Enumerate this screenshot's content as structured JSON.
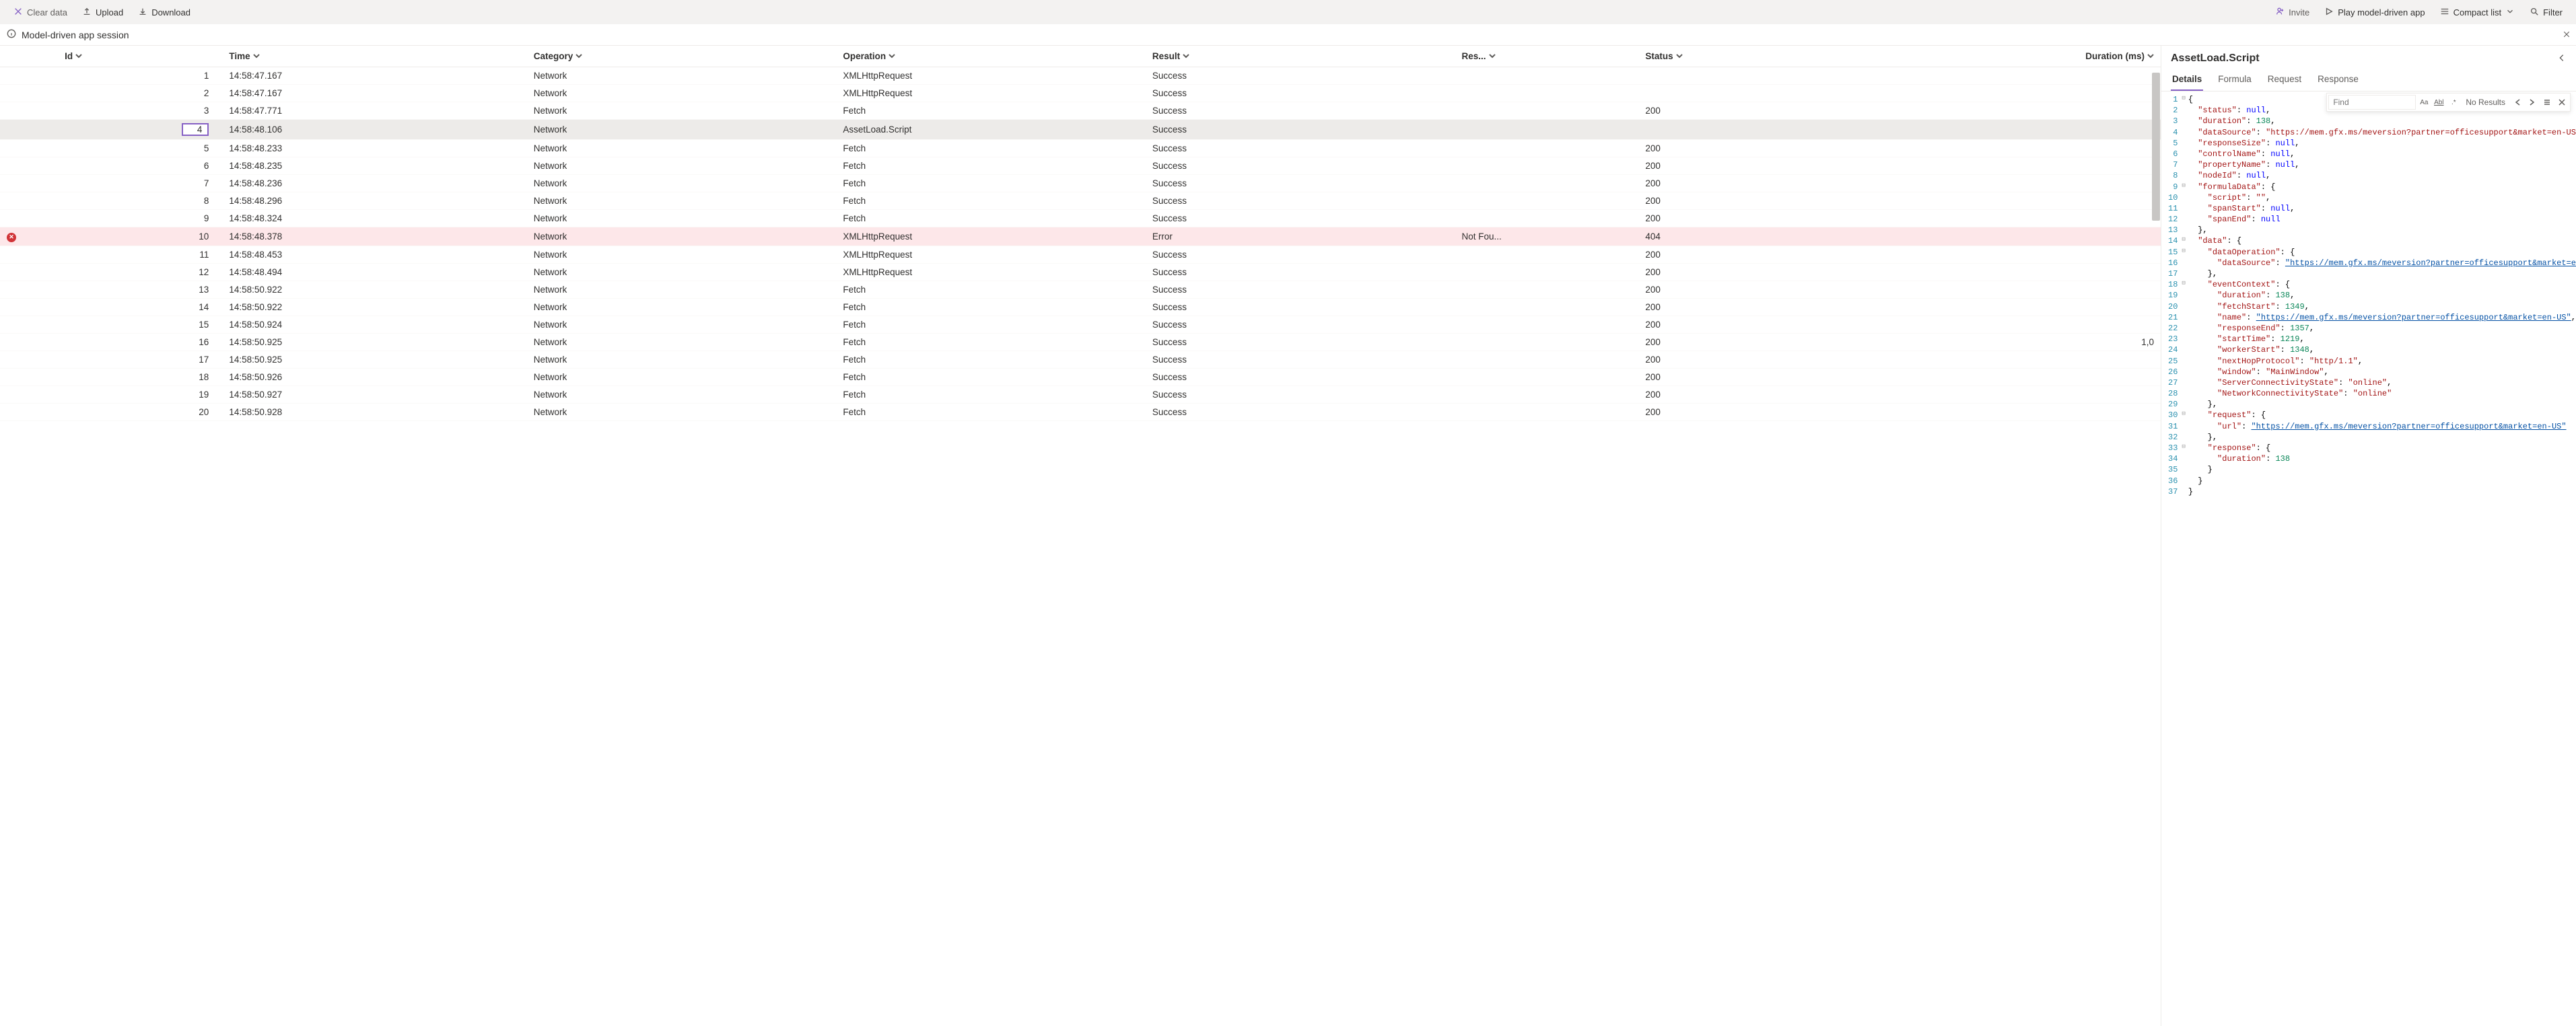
{
  "toolbar": {
    "clear": "Clear data",
    "upload": "Upload",
    "download": "Download",
    "invite": "Invite",
    "play": "Play model-driven app",
    "compact": "Compact list",
    "filter": "Filter"
  },
  "session": {
    "title": "Model-driven app session"
  },
  "table": {
    "headers": {
      "id": "Id",
      "time": "Time",
      "category": "Category",
      "operation": "Operation",
      "result": "Result",
      "result_msg": "Res...",
      "status": "Status",
      "duration": "Duration (ms)"
    },
    "rows": [
      {
        "id": 1,
        "time": "14:58:47.167",
        "cat": "Network",
        "op": "XMLHttpRequest",
        "res": "Success",
        "msg": "",
        "status": "",
        "dur": ""
      },
      {
        "id": 2,
        "time": "14:58:47.167",
        "cat": "Network",
        "op": "XMLHttpRequest",
        "res": "Success",
        "msg": "",
        "status": "",
        "dur": ""
      },
      {
        "id": 3,
        "time": "14:58:47.771",
        "cat": "Network",
        "op": "Fetch",
        "res": "Success",
        "msg": "",
        "status": "200",
        "dur": ""
      },
      {
        "id": 4,
        "time": "14:58:48.106",
        "cat": "Network",
        "op": "AssetLoad.Script",
        "res": "Success",
        "msg": "",
        "status": "",
        "dur": "",
        "selected": true
      },
      {
        "id": 5,
        "time": "14:58:48.233",
        "cat": "Network",
        "op": "Fetch",
        "res": "Success",
        "msg": "",
        "status": "200",
        "dur": ""
      },
      {
        "id": 6,
        "time": "14:58:48.235",
        "cat": "Network",
        "op": "Fetch",
        "res": "Success",
        "msg": "",
        "status": "200",
        "dur": ""
      },
      {
        "id": 7,
        "time": "14:58:48.236",
        "cat": "Network",
        "op": "Fetch",
        "res": "Success",
        "msg": "",
        "status": "200",
        "dur": ""
      },
      {
        "id": 8,
        "time": "14:58:48.296",
        "cat": "Network",
        "op": "Fetch",
        "res": "Success",
        "msg": "",
        "status": "200",
        "dur": ""
      },
      {
        "id": 9,
        "time": "14:58:48.324",
        "cat": "Network",
        "op": "Fetch",
        "res": "Success",
        "msg": "",
        "status": "200",
        "dur": ""
      },
      {
        "id": 10,
        "time": "14:58:48.378",
        "cat": "Network",
        "op": "XMLHttpRequest",
        "res": "Error",
        "msg": "Not Fou...",
        "status": "404",
        "dur": "",
        "error": true
      },
      {
        "id": 11,
        "time": "14:58:48.453",
        "cat": "Network",
        "op": "XMLHttpRequest",
        "res": "Success",
        "msg": "",
        "status": "200",
        "dur": ""
      },
      {
        "id": 12,
        "time": "14:58:48.494",
        "cat": "Network",
        "op": "XMLHttpRequest",
        "res": "Success",
        "msg": "",
        "status": "200",
        "dur": ""
      },
      {
        "id": 13,
        "time": "14:58:50.922",
        "cat": "Network",
        "op": "Fetch",
        "res": "Success",
        "msg": "",
        "status": "200",
        "dur": ""
      },
      {
        "id": 14,
        "time": "14:58:50.922",
        "cat": "Network",
        "op": "Fetch",
        "res": "Success",
        "msg": "",
        "status": "200",
        "dur": ""
      },
      {
        "id": 15,
        "time": "14:58:50.924",
        "cat": "Network",
        "op": "Fetch",
        "res": "Success",
        "msg": "",
        "status": "200",
        "dur": ""
      },
      {
        "id": 16,
        "time": "14:58:50.925",
        "cat": "Network",
        "op": "Fetch",
        "res": "Success",
        "msg": "",
        "status": "200",
        "dur": "1,0"
      },
      {
        "id": 17,
        "time": "14:58:50.925",
        "cat": "Network",
        "op": "Fetch",
        "res": "Success",
        "msg": "",
        "status": "200",
        "dur": ""
      },
      {
        "id": 18,
        "time": "14:58:50.926",
        "cat": "Network",
        "op": "Fetch",
        "res": "Success",
        "msg": "",
        "status": "200",
        "dur": ""
      },
      {
        "id": 19,
        "time": "14:58:50.927",
        "cat": "Network",
        "op": "Fetch",
        "res": "Success",
        "msg": "",
        "status": "200",
        "dur": ""
      },
      {
        "id": 20,
        "time": "14:58:50.928",
        "cat": "Network",
        "op": "Fetch",
        "res": "Success",
        "msg": "",
        "status": "200",
        "dur": ""
      }
    ]
  },
  "right": {
    "title": "AssetLoad.Script",
    "tabs": {
      "details": "Details",
      "formula": "Formula",
      "request": "Request",
      "response": "Response"
    },
    "find": {
      "placeholder": "Find",
      "noresults": "No Results",
      "matchcase": "Aa",
      "wholeword": "Abl",
      "regex": ".*"
    }
  },
  "code": {
    "lines": [
      {
        "n": 1,
        "f": "-",
        "html": "<span class='p'>{</span>"
      },
      {
        "n": 2,
        "html": "  <span class='k'>\"status\"</span><span class='p'>: </span><span class='c-null'>null</span><span class='p'>,</span>"
      },
      {
        "n": 3,
        "html": "  <span class='k'>\"duration\"</span><span class='p'>: </span><span class='n'>138</span><span class='p'>,</span>"
      },
      {
        "n": 4,
        "html": "  <span class='k'>\"dataSource\"</span><span class='p'>: </span><span class='k'>\"https://mem.gfx.ms/meversion?partner=officesupport&amp;market=en-US\"</span><span class='p'>,</span>"
      },
      {
        "n": 5,
        "html": "  <span class='k'>\"responseSize\"</span><span class='p'>: </span><span class='c-null'>null</span><span class='p'>,</span>"
      },
      {
        "n": 6,
        "html": "  <span class='k'>\"controlName\"</span><span class='p'>: </span><span class='c-null'>null</span><span class='p'>,</span>"
      },
      {
        "n": 7,
        "html": "  <span class='k'>\"propertyName\"</span><span class='p'>: </span><span class='c-null'>null</span><span class='p'>,</span>"
      },
      {
        "n": 8,
        "html": "  <span class='k'>\"nodeId\"</span><span class='p'>: </span><span class='c-null'>null</span><span class='p'>,</span>"
      },
      {
        "n": 9,
        "f": "-",
        "html": "  <span class='k'>\"formulaData\"</span><span class='p'>: {</span>"
      },
      {
        "n": 10,
        "html": "    <span class='k'>\"script\"</span><span class='p'>: </span><span class='k'>\"\"</span><span class='p'>,</span>"
      },
      {
        "n": 11,
        "html": "    <span class='k'>\"spanStart\"</span><span class='p'>: </span><span class='c-null'>null</span><span class='p'>,</span>"
      },
      {
        "n": 12,
        "html": "    <span class='k'>\"spanEnd\"</span><span class='p'>: </span><span class='c-null'>null</span>"
      },
      {
        "n": 13,
        "html": "  <span class='p'>},</span>"
      },
      {
        "n": 14,
        "f": "-",
        "html": "  <span class='k'>\"data\"</span><span class='p'>: {</span>"
      },
      {
        "n": 15,
        "f": "-",
        "html": "    <span class='k'>\"dataOperation\"</span><span class='p'>: {</span>"
      },
      {
        "n": 16,
        "html": "      <span class='k'>\"dataSource\"</span><span class='p'>: </span><span class='u'>\"https://mem.gfx.ms/meversion?partner=officesupport&amp;market=en-US\"</span>"
      },
      {
        "n": 17,
        "html": "    <span class='p'>},</span>"
      },
      {
        "n": 18,
        "f": "-",
        "html": "    <span class='k'>\"eventContext\"</span><span class='p'>: {</span>"
      },
      {
        "n": 19,
        "html": "      <span class='k'>\"duration\"</span><span class='p'>: </span><span class='n'>138</span><span class='p'>,</span>"
      },
      {
        "n": 20,
        "html": "      <span class='k'>\"fetchStart\"</span><span class='p'>: </span><span class='n'>1349</span><span class='p'>,</span>"
      },
      {
        "n": 21,
        "html": "      <span class='k'>\"name\"</span><span class='p'>: </span><span class='u'>\"https://mem.gfx.ms/meversion?partner=officesupport&amp;market=en-US\"</span><span class='p'>,</span>"
      },
      {
        "n": 22,
        "html": "      <span class='k'>\"responseEnd\"</span><span class='p'>: </span><span class='n'>1357</span><span class='p'>,</span>"
      },
      {
        "n": 23,
        "html": "      <span class='k'>\"startTime\"</span><span class='p'>: </span><span class='n'>1219</span><span class='p'>,</span>"
      },
      {
        "n": 24,
        "html": "      <span class='k'>\"workerStart\"</span><span class='p'>: </span><span class='n'>1348</span><span class='p'>,</span>"
      },
      {
        "n": 25,
        "html": "      <span class='k'>\"nextHopProtocol\"</span><span class='p'>: </span><span class='k'>\"http/1.1\"</span><span class='p'>,</span>"
      },
      {
        "n": 26,
        "html": "      <span class='k'>\"window\"</span><span class='p'>: </span><span class='k'>\"MainWindow\"</span><span class='p'>,</span>"
      },
      {
        "n": 27,
        "html": "      <span class='k'>\"ServerConnectivityState\"</span><span class='p'>: </span><span class='k'>\"online\"</span><span class='p'>,</span>"
      },
      {
        "n": 28,
        "html": "      <span class='k'>\"NetworkConnectivityState\"</span><span class='p'>: </span><span class='k'>\"online\"</span>"
      },
      {
        "n": 29,
        "html": "    <span class='p'>},</span>"
      },
      {
        "n": 30,
        "f": "-",
        "html": "    <span class='k'>\"request\"</span><span class='p'>: {</span>"
      },
      {
        "n": 31,
        "html": "      <span class='k'>\"url\"</span><span class='p'>: </span><span class='u'>\"https://mem.gfx.ms/meversion?partner=officesupport&amp;market=en-US\"</span>"
      },
      {
        "n": 32,
        "html": "    <span class='p'>},</span>"
      },
      {
        "n": 33,
        "f": "-",
        "html": "    <span class='k'>\"response\"</span><span class='p'>: {</span>"
      },
      {
        "n": 34,
        "html": "      <span class='k'>\"duration\"</span><span class='p'>: </span><span class='n'>138</span>"
      },
      {
        "n": 35,
        "html": "    <span class='p'>}</span>"
      },
      {
        "n": 36,
        "html": "  <span class='p'>}</span>"
      },
      {
        "n": 37,
        "html": "<span class='p'>}</span>"
      }
    ]
  }
}
